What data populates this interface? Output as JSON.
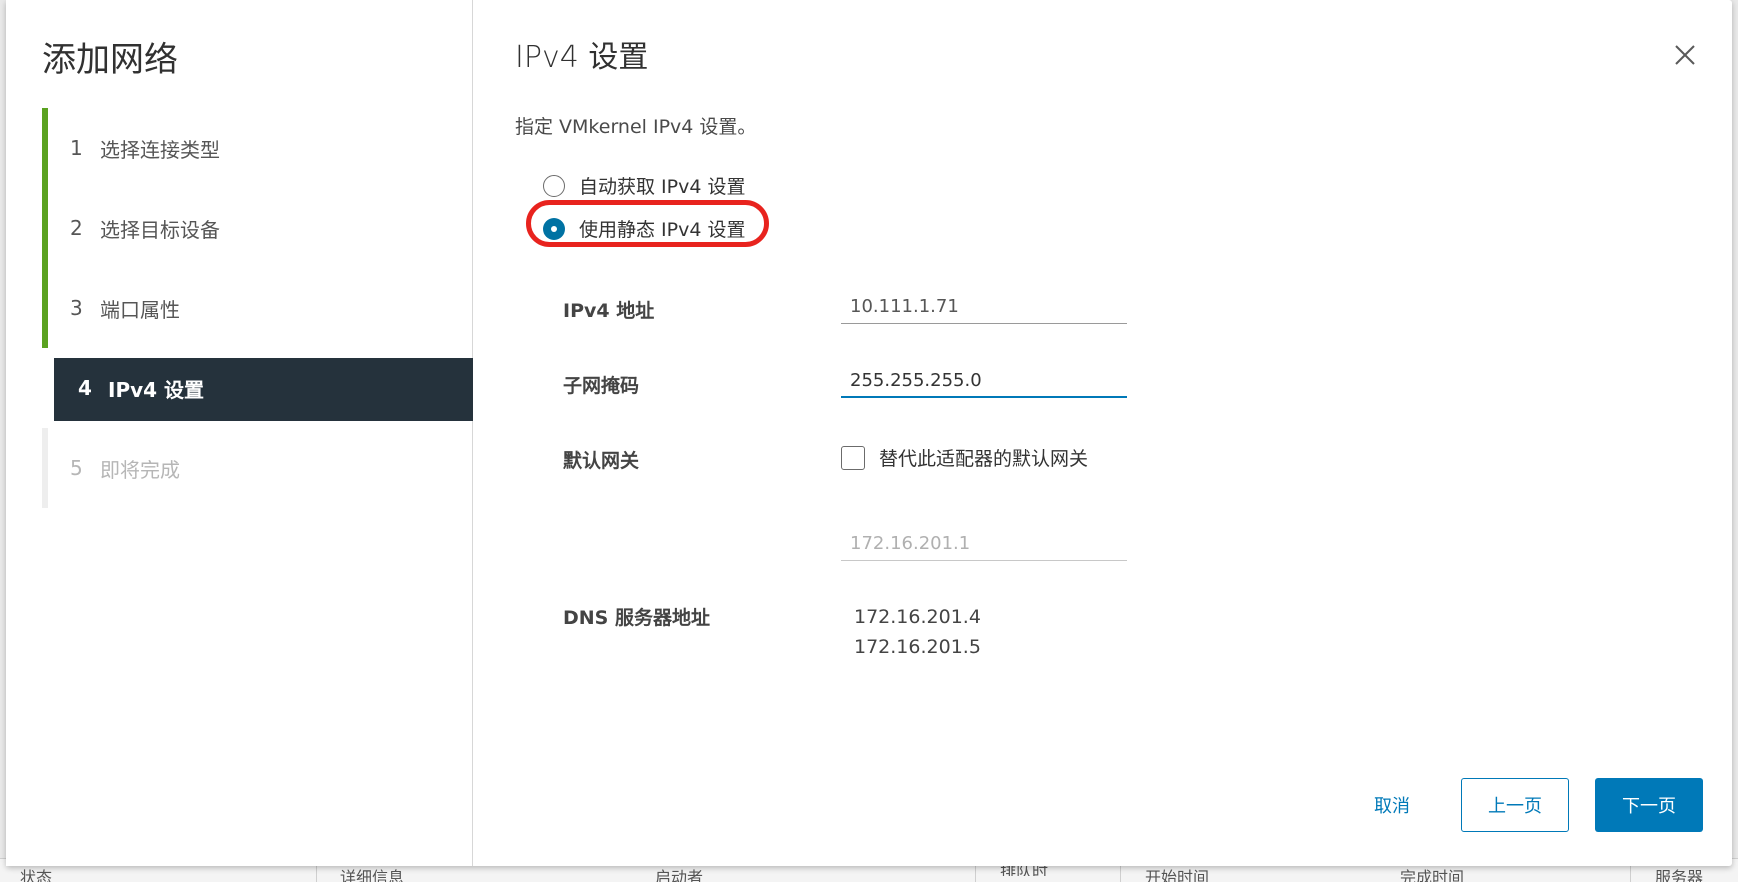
{
  "background_table": {
    "columns": [
      "状态",
      "详细信息",
      "启动者",
      "排队时",
      "开始时间",
      "完成时间",
      "服务器"
    ]
  },
  "wizard": {
    "title": "添加网络",
    "steps": [
      {
        "num": "1",
        "label": "选择连接类型",
        "state": "done"
      },
      {
        "num": "2",
        "label": "选择目标设备",
        "state": "done"
      },
      {
        "num": "3",
        "label": "端口属性",
        "state": "done"
      },
      {
        "num": "4",
        "label": "IPv4 设置",
        "state": "active"
      },
      {
        "num": "5",
        "label": "即将完成",
        "state": "pending"
      }
    ]
  },
  "page": {
    "title": "IPv4 设置",
    "description": "指定 VMkernel IPv4 设置。",
    "radio_auto": "自动获取 IPv4 设置",
    "radio_static": "使用静态 IPv4 设置",
    "selected_option": "static"
  },
  "form": {
    "ipv4_label": "IPv4 地址",
    "ipv4_value": "10.111.1.71",
    "subnet_label": "子网掩码",
    "subnet_value": "255.255.255.0",
    "gateway_label": "默认网关",
    "gateway_override_label": "替代此适配器的默认网关",
    "gateway_override_checked": false,
    "gateway_value": "172.16.201.1",
    "dns_label": "DNS 服务器地址",
    "dns_servers": [
      "172.16.201.4",
      "172.16.201.5"
    ]
  },
  "footer": {
    "cancel": "取消",
    "prev": "上一页",
    "next": "下一页"
  },
  "colors": {
    "accent": "#0079b8",
    "step_done": "#5aa220",
    "active_step_bg": "#25323c",
    "highlight_ring": "#e8231e"
  }
}
